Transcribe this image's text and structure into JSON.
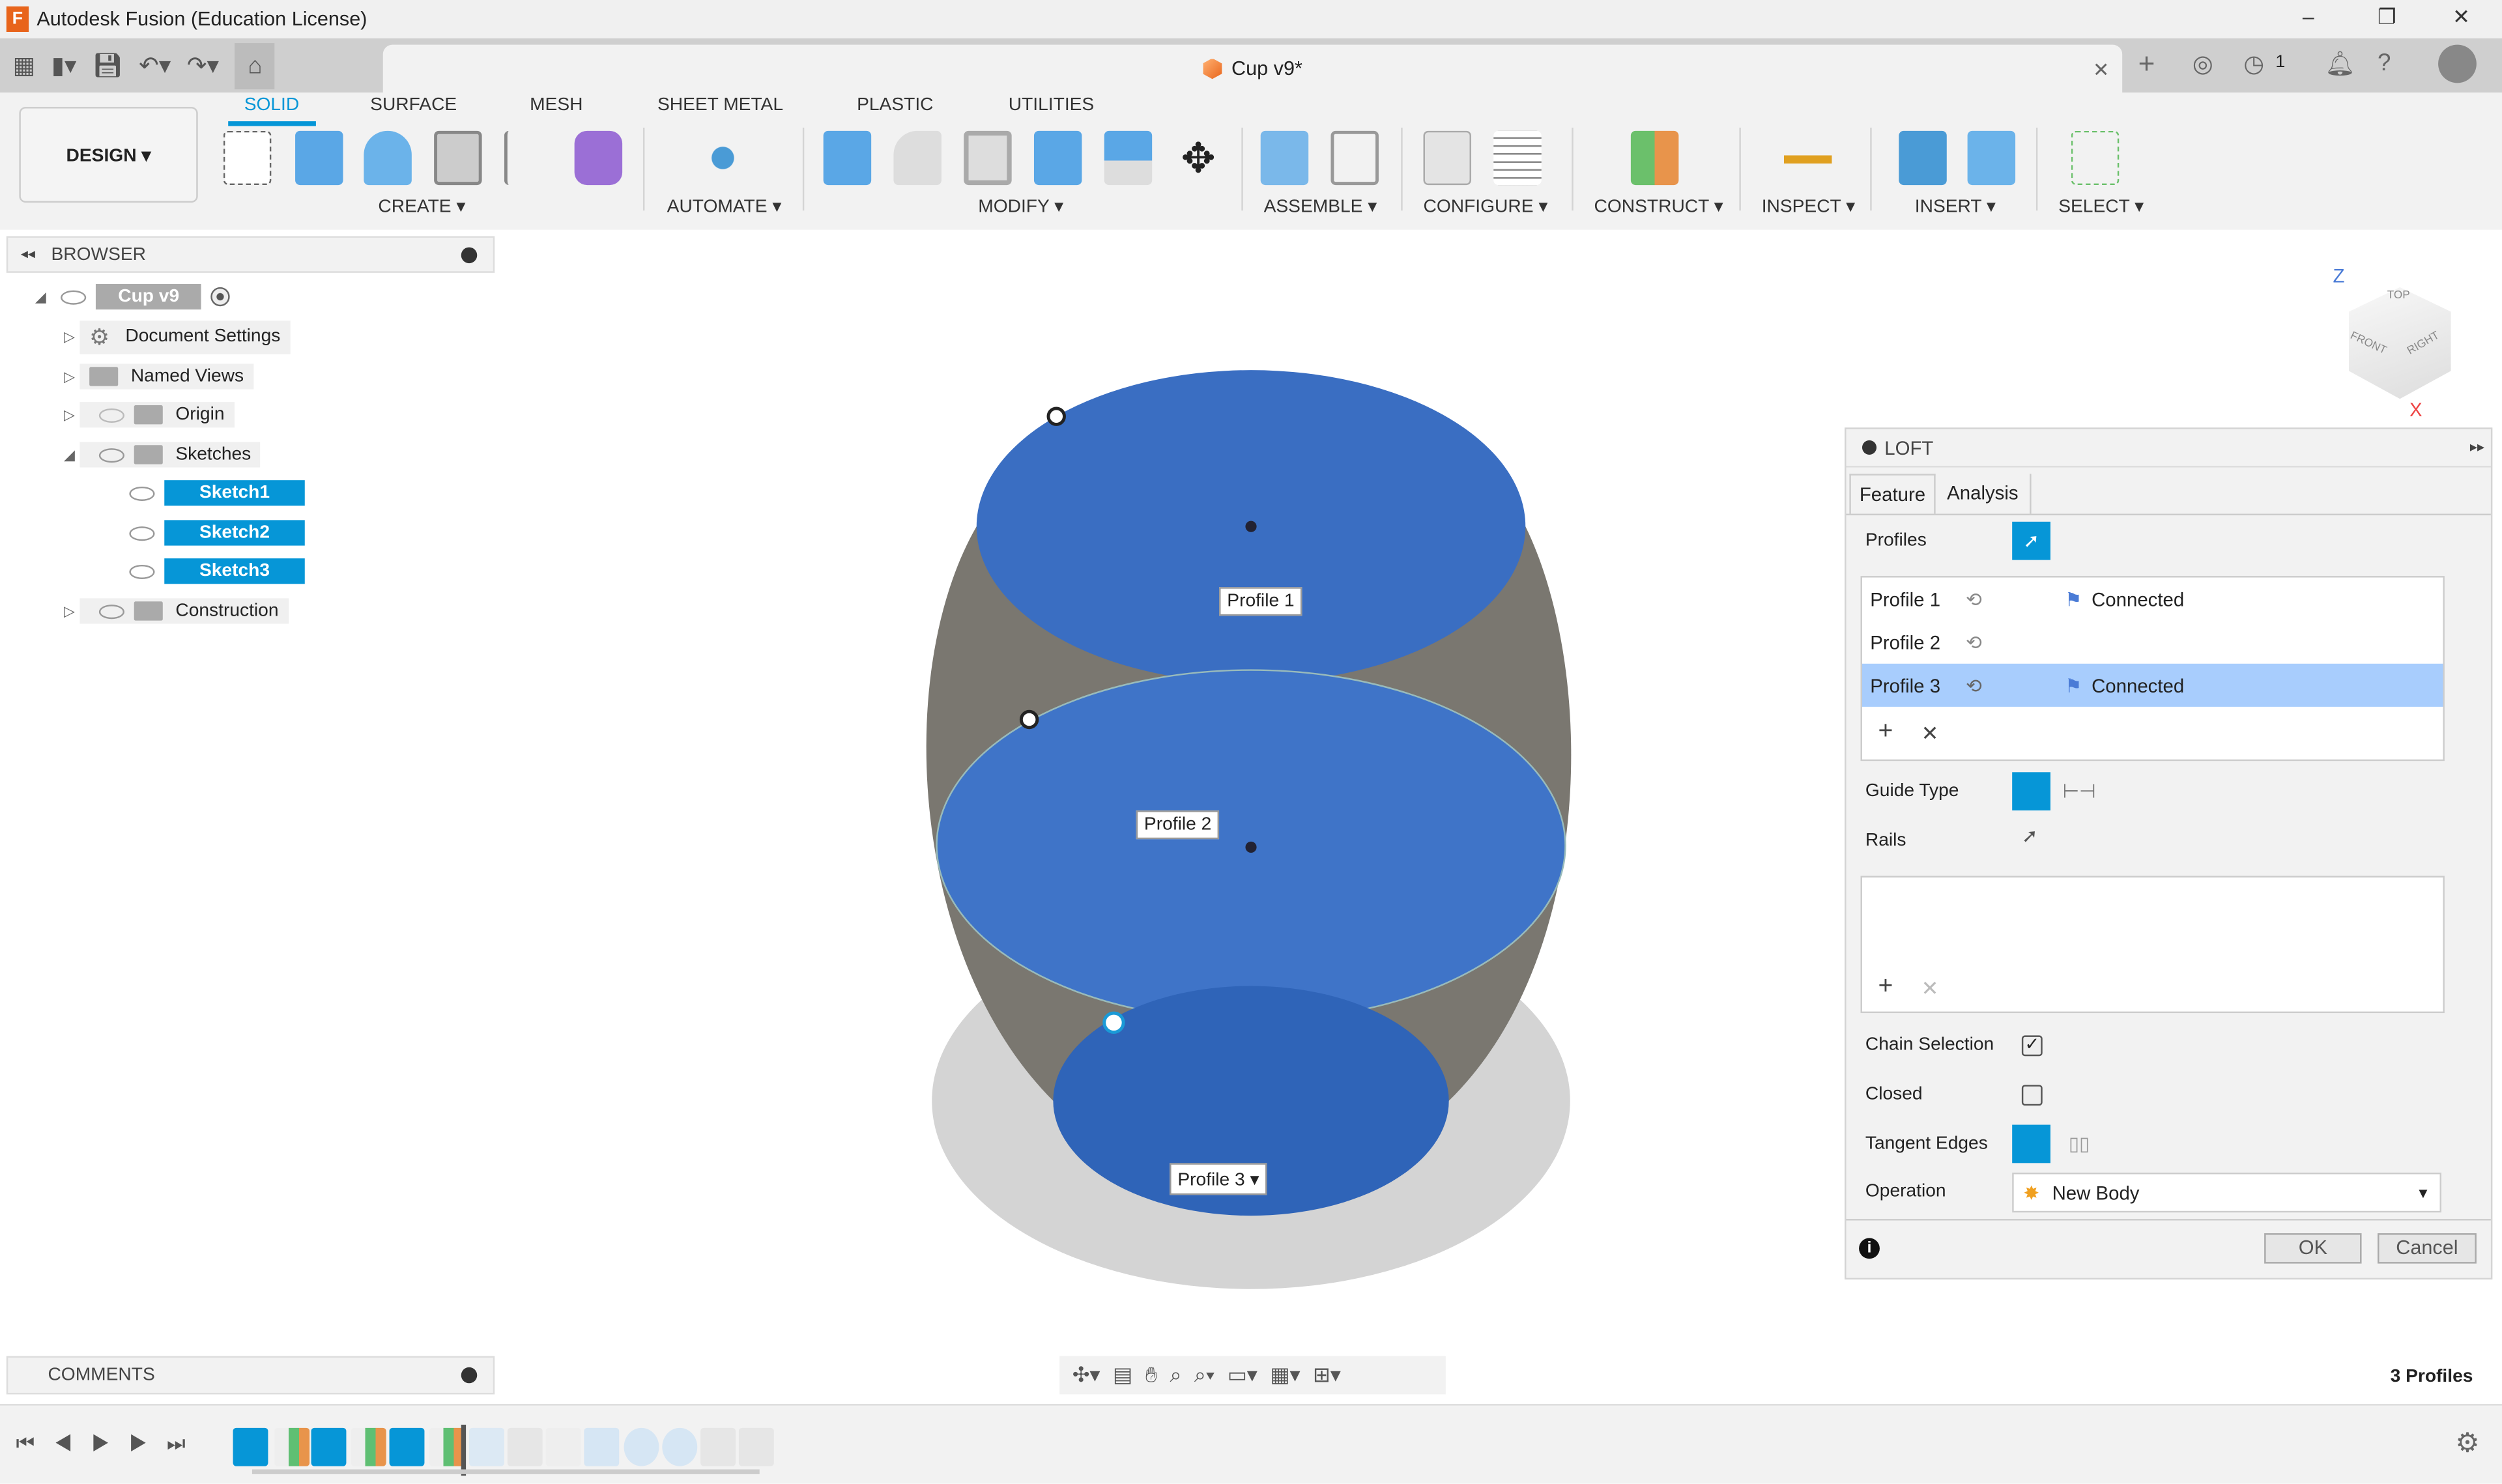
{
  "window": {
    "title": "Autodesk Fusion (Education License)",
    "logo": "F",
    "minimize": "–",
    "restore": "❐",
    "close": "✕"
  },
  "document_tab": {
    "title": "Cup v9*",
    "close": "✕"
  },
  "top_right": {
    "jobs_count": "1"
  },
  "ribbon": {
    "workspace": "DESIGN ▾",
    "tabs": [
      "SOLID",
      "SURFACE",
      "MESH",
      "SHEET METAL",
      "PLASTIC",
      "UTILITIES"
    ],
    "active_tab": "SOLID",
    "groups": [
      "CREATE ▾",
      "AUTOMATE ▾",
      "MODIFY ▾",
      "ASSEMBLE ▾",
      "CONFIGURE ▾",
      "CONSTRUCT ▾",
      "INSPECT ▾",
      "INSERT ▾",
      "SELECT ▾"
    ]
  },
  "browser": {
    "title": "BROWSER",
    "root": "Cup v9",
    "items": [
      {
        "label": "Document Settings",
        "icon": "gear-icon"
      },
      {
        "label": "Named Views",
        "icon": "folder-icon"
      },
      {
        "label": "Origin",
        "icon": "folder-icon"
      },
      {
        "label": "Sketches",
        "icon": "folder-icon"
      },
      {
        "label": "Sketch1",
        "icon": "sketch-icon"
      },
      {
        "label": "Sketch2",
        "icon": "sketch-icon"
      },
      {
        "label": "Sketch3",
        "icon": "sketch-icon"
      },
      {
        "label": "Construction",
        "icon": "folder-icon"
      }
    ]
  },
  "viewport": {
    "profile_labels": [
      "Profile 1",
      "Profile 2",
      "Profile 3"
    ],
    "profile3_dropdown": "▾",
    "viewcube": {
      "top": "TOP",
      "front": "FRONT",
      "right": "RIGHT",
      "z": "Z",
      "x": "X"
    }
  },
  "loft": {
    "title": "LOFT",
    "tabs": [
      "Feature",
      "Analysis"
    ],
    "profiles_label": "Profiles",
    "profiles": [
      {
        "name": "Profile 1",
        "status": "Connected"
      },
      {
        "name": "Profile 2",
        "status": ""
      },
      {
        "name": "Profile 3",
        "status": "Connected",
        "selected": true
      }
    ],
    "add": "+",
    "remove": "✕",
    "guide_type_label": "Guide Type",
    "rails_label": "Rails",
    "chain_selection_label": "Chain Selection",
    "chain_selection": true,
    "closed_label": "Closed",
    "closed": false,
    "tangent_edges_label": "Tangent Edges",
    "operation_label": "Operation",
    "operation": "New Body",
    "ok": "OK",
    "cancel": "Cancel"
  },
  "comments": {
    "title": "COMMENTS"
  },
  "status": {
    "selection": "3 Profiles"
  },
  "colors": {
    "accent": "#0696d7",
    "selected_row": "#a8cdfd",
    "profile_fill": "#2f64b8"
  }
}
